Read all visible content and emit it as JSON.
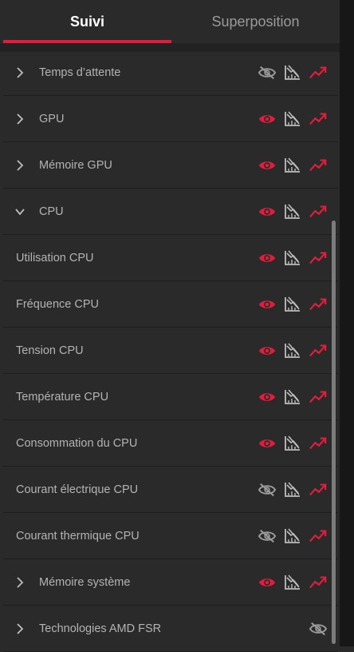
{
  "colors": {
    "accent": "#e01e3c",
    "icon_inactive": "#9c9c9c",
    "background": "#2a2a2b"
  },
  "tabs": [
    {
      "label": "Suivi",
      "active": true
    },
    {
      "label": "Superposition",
      "active": false
    }
  ],
  "rows": [
    {
      "label": "Temps d’attente",
      "kind": "group",
      "expanded": false,
      "visible": false,
      "graph": true,
      "trend": true
    },
    {
      "label": "GPU",
      "kind": "group",
      "expanded": false,
      "visible": true,
      "graph": true,
      "trend": true
    },
    {
      "label": "Mémoire GPU",
      "kind": "group",
      "expanded": false,
      "visible": true,
      "graph": true,
      "trend": true
    },
    {
      "label": "CPU",
      "kind": "group",
      "expanded": true,
      "visible": true,
      "graph": true,
      "trend": true
    },
    {
      "label": "Utilisation CPU",
      "kind": "child",
      "visible": true,
      "graph": true,
      "trend": true
    },
    {
      "label": "Fréquence CPU",
      "kind": "child",
      "visible": true,
      "graph": true,
      "trend": true
    },
    {
      "label": "Tension CPU",
      "kind": "child",
      "visible": true,
      "graph": true,
      "trend": true
    },
    {
      "label": "Température CPU",
      "kind": "child",
      "visible": true,
      "graph": true,
      "trend": true
    },
    {
      "label": "Consommation du CPU",
      "kind": "child",
      "visible": true,
      "graph": true,
      "trend": true
    },
    {
      "label": "Courant électrique CPU",
      "kind": "child",
      "visible": false,
      "graph": true,
      "trend": true
    },
    {
      "label": "Courant thermique CPU",
      "kind": "child",
      "visible": false,
      "graph": true,
      "trend": true
    },
    {
      "label": "Mémoire système",
      "kind": "group",
      "expanded": false,
      "visible": true,
      "graph": true,
      "trend": true
    },
    {
      "label": "Technologies AMD FSR",
      "kind": "group",
      "expanded": false,
      "visible": false,
      "graph": false,
      "trend": false
    }
  ]
}
